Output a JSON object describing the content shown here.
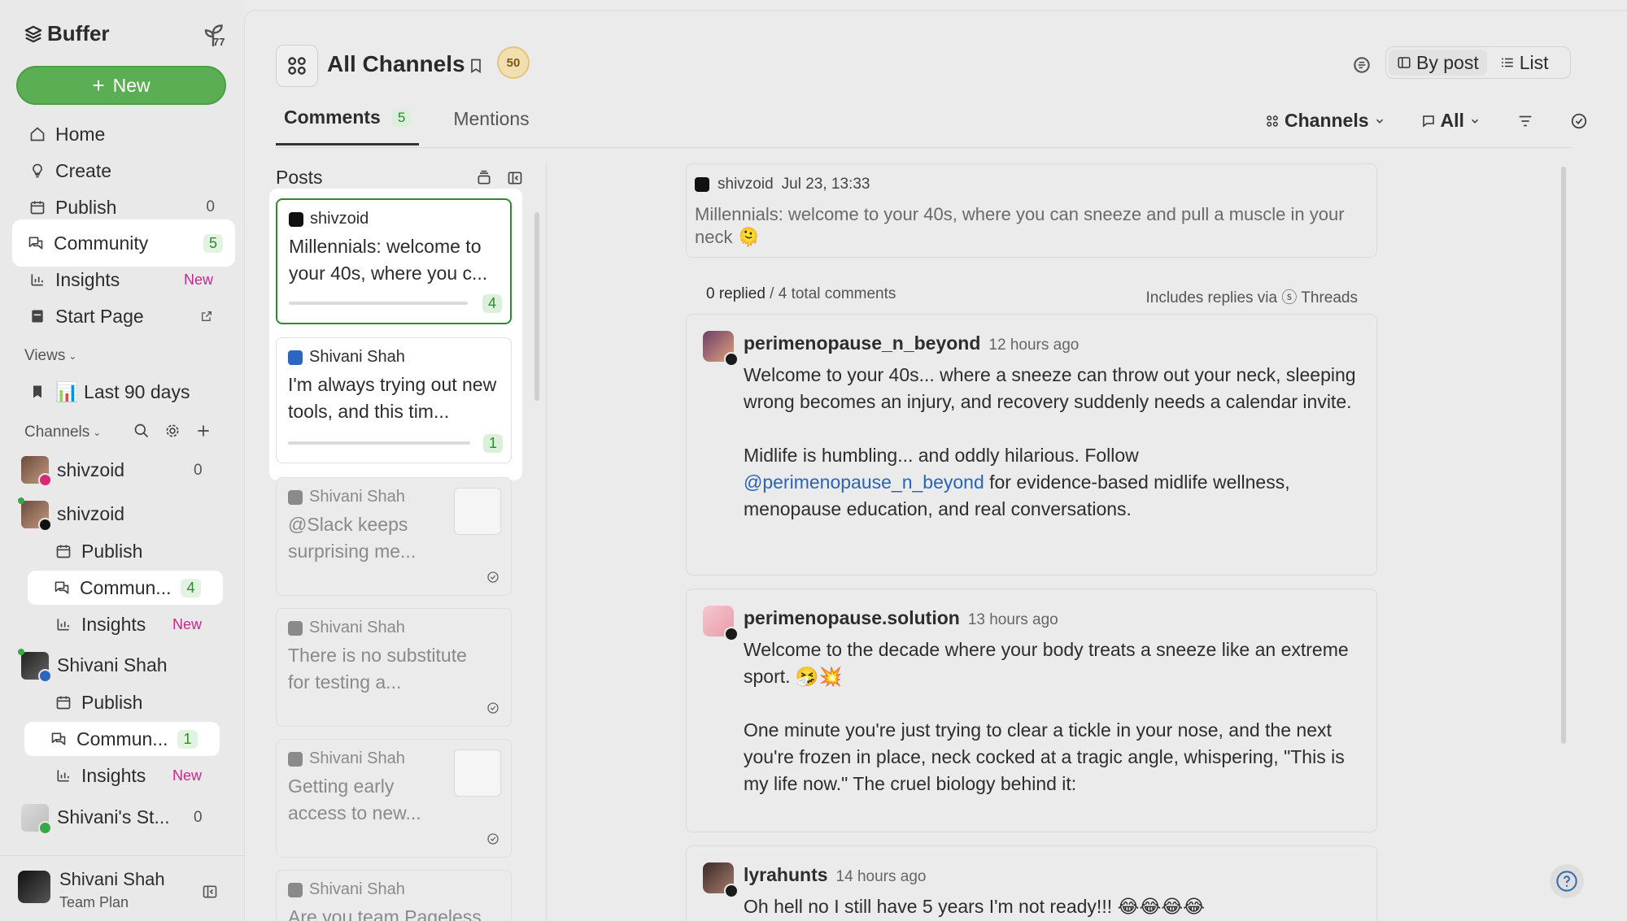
{
  "app": {
    "name": "Buffer",
    "sprout_count": "77",
    "new_label": "New"
  },
  "nav": {
    "home": "Home",
    "create": "Create",
    "publish": "Publish",
    "publish_count": "0",
    "community": "Community",
    "community_count": "5",
    "insights": "Insights",
    "insights_badge": "New",
    "start_page": "Start Page"
  },
  "views": {
    "label": "Views",
    "item": "📊 Last 90 days"
  },
  "channels": {
    "label": "Channels",
    "list": [
      {
        "name": "shivzoid",
        "count": "0",
        "network": "instagram"
      },
      {
        "name": "shivzoid",
        "network": "threads",
        "sub": {
          "publish": "Publish",
          "community": "Commun...",
          "community_count": "4",
          "insights": "Insights",
          "insights_badge": "New"
        }
      },
      {
        "name": "Shivani Shah",
        "network": "linkedin",
        "sub": {
          "publish": "Publish",
          "community": "Commun...",
          "community_count": "1",
          "insights": "Insights",
          "insights_badge": "New"
        }
      },
      {
        "name": "Shivani's St...",
        "count": "0",
        "network": "startpage"
      }
    ]
  },
  "user": {
    "name": "Shivani Shah",
    "plan": "Team Plan"
  },
  "header": {
    "title": "All Channels",
    "level": "50",
    "view_by_post": "By post",
    "view_list": "List"
  },
  "tabs": [
    {
      "label": "Comments",
      "count": "5"
    },
    {
      "label": "Mentions"
    }
  ],
  "filters": {
    "channels": "Channels",
    "all": "All"
  },
  "posts": {
    "header": "Posts",
    "items": [
      {
        "author": "shivzoid",
        "network": "threads",
        "text": "Millennials: welcome to your 40s, where you c...",
        "count": "4"
      },
      {
        "author": "Shivani Shah",
        "network": "linkedin",
        "text": "I'm always trying out new tools, and this tim...",
        "count": "1"
      },
      {
        "author": "Shivani Shah",
        "network": "linkedin",
        "text": "@Slack keeps surprising me..."
      },
      {
        "author": "Shivani Shah",
        "network": "linkedin",
        "text": "There is no substitute for testing a..."
      },
      {
        "author": "Shivani Shah",
        "network": "linkedin",
        "text": "Getting early access to new..."
      },
      {
        "author": "Shivani Shah",
        "network": "linkedin",
        "text": "Are you team Pageless"
      }
    ]
  },
  "original_post": {
    "author": "shivzoid",
    "date": "Jul 23, 13:33",
    "text": "Millennials: welcome to your 40s, where you can sneeze and pull a muscle in your neck 🫠"
  },
  "stats": {
    "replied": "0 replied",
    "total": " / 4 total comments",
    "includes": "Includes replies via ⓢ Threads"
  },
  "comments": [
    {
      "author": "perimenopause_n_beyond",
      "time": "12 hours ago",
      "p1": "Welcome to your 40s... where a sneeze can throw out your neck, sleeping wrong becomes an injury, and recovery suddenly needs a calendar invite.",
      "p2_before": "Midlife is humbling... and oddly hilarious. Follow ",
      "p2_link": "@perimenopause_n_beyond",
      "p2_after": " for evidence-based midlife wellness, menopause education, and real conversations."
    },
    {
      "author": "perimenopause.solution",
      "time": "13 hours ago",
      "p1": "Welcome to the decade where your body treats a sneeze like an extreme sport. 🤧💥",
      "p2": "One minute you're just trying to clear a tickle in your nose, and the next you're frozen in place, neck cocked at a tragic angle, whispering, \"This is my life now.\" The cruel biology behind it:"
    },
    {
      "author": "lyrahunts",
      "time": "14 hours ago",
      "p1": "Oh hell no I still have 5 years I'm not ready!!! 😂😂😂😂"
    }
  ],
  "colors": {
    "accent_green": "#5cae55",
    "badge_new": "#c9288c",
    "link": "#2a64b8"
  }
}
